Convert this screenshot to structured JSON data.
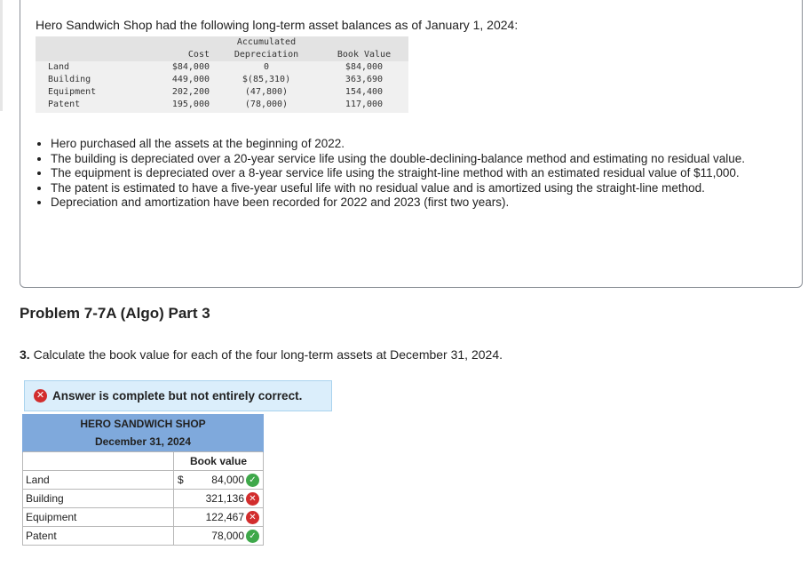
{
  "intro": "Hero Sandwich Shop had the following long-term asset balances as of January 1, 2024:",
  "balances": {
    "headers": {
      "cost": "Cost",
      "acc_line1": "Accumulated",
      "acc_line2": "Depreciation",
      "book": "Book Value"
    },
    "rows": [
      {
        "asset": "Land",
        "cost": "$84,000",
        "acc": "0",
        "book": "$84,000"
      },
      {
        "asset": "Building",
        "cost": "449,000",
        "acc": "$(85,310)",
        "book": "363,690"
      },
      {
        "asset": "Equipment",
        "cost": "202,200",
        "acc": "(47,800)",
        "book": "154,400"
      },
      {
        "asset": "Patent",
        "cost": "195,000",
        "acc": "(78,000)",
        "book": "117,000"
      }
    ]
  },
  "bullets": [
    "Hero purchased all the assets at the beginning of 2022.",
    "The building is depreciated over a 20-year service life using the double-declining-balance method and estimating no residual value.",
    "The equipment is depreciated over a 8-year service life using the straight-line method with an estimated residual value of $11,000.",
    "The patent is estimated to have a five-year useful life with no residual value and is amortized using the straight-line method.",
    "Depreciation and amortization have been recorded for 2022 and 2023 (first two years)."
  ],
  "part_title": "Problem 7-7A (Algo) Part 3",
  "question": {
    "number": "3.",
    "text": "Calculate the book value for each of the four long-term assets at December 31, 2024."
  },
  "alert": {
    "text": "Answer is complete but not entirely correct."
  },
  "answer_table": {
    "company": "HERO SANDWICH SHOP",
    "date": "December 31, 2024",
    "column": "Book value",
    "currency": "$",
    "rows": [
      {
        "label": "Land",
        "value": "84,000",
        "status": "correct"
      },
      {
        "label": "Building",
        "value": "321,136",
        "status": "incorrect"
      },
      {
        "label": "Equipment",
        "value": "122,467",
        "status": "incorrect"
      },
      {
        "label": "Patent",
        "value": "78,000",
        "status": "correct"
      }
    ]
  },
  "colors": {
    "header_blue": "#7fa9dc",
    "correct": "#3ea84a",
    "incorrect": "#d22d2d",
    "alert_bg": "#dbeefb"
  }
}
